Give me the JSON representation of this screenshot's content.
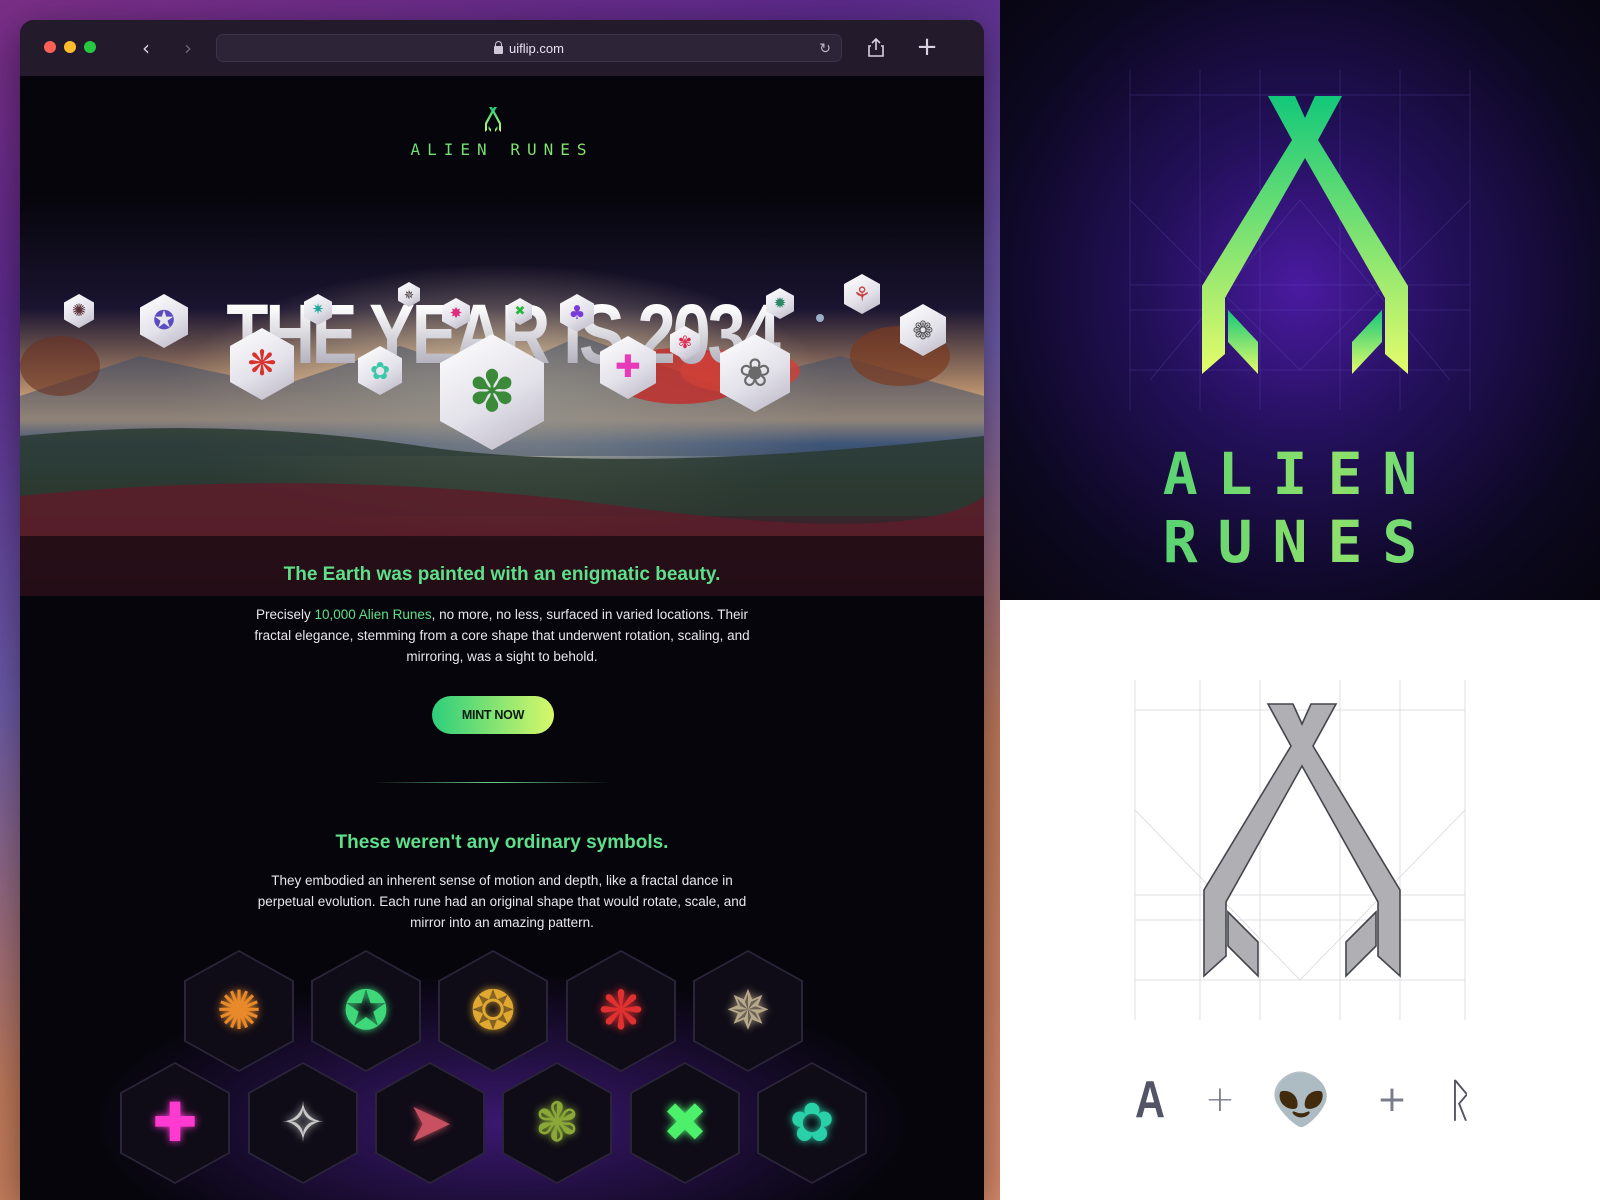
{
  "browser": {
    "url": "uiflip.com",
    "nav_back": "‹",
    "nav_forward": "›",
    "reload": "↻",
    "new_tab": "+"
  },
  "site": {
    "brand": "ALIEN RUNES",
    "hero_title": "THE YEAR IS 2034",
    "tagline": "The Earth was painted with an enigmatic beauty.",
    "para1_pre": "Precisely ",
    "para1_highlight": "10,000 Alien Runes",
    "para1_post": ", no more, no less, surfaced in varied locations. Their fractal elegance, stemming from a core shape that underwent rotation, scaling, and mirroring, was a sight to behold.",
    "cta": "MINT NOW",
    "subhead": "These weren't any ordinary symbols.",
    "para2": "They embodied an inherent sense of motion and depth, like a fractal dance in perpetual evolution. Each rune had an original shape that would rotate, scale, and mirror into an amazing pattern."
  },
  "hero_runes": [
    {
      "glyph": "✺",
      "color": "#5a3038"
    },
    {
      "glyph": "✪",
      "color": "#5a4cc0"
    },
    {
      "glyph": "❋",
      "color": "#d8322e"
    },
    {
      "glyph": "✷",
      "color": "#1ea89a"
    },
    {
      "glyph": "✿",
      "color": "#3ac8a8"
    },
    {
      "glyph": "✵",
      "color": "#403838"
    },
    {
      "glyph": "✸",
      "color": "#e02a7a"
    },
    {
      "glyph": "♣",
      "color": "#7a3ad8"
    },
    {
      "glyph": "✖",
      "color": "#2ab840"
    },
    {
      "glyph": "✚",
      "color": "#e83ab8"
    },
    {
      "glyph": "✾",
      "color": "#d8284c"
    },
    {
      "glyph": "❀",
      "color": "#6a6a6a"
    },
    {
      "glyph": "✹",
      "color": "#2a8a68"
    },
    {
      "glyph": "⚘",
      "color": "#c84040"
    },
    {
      "glyph": "❁",
      "color": "#555555"
    },
    {
      "glyph": "✽",
      "color": "#3a8a3a"
    }
  ],
  "rune_grid": [
    {
      "glyph": "✺",
      "color": "#e88a2a"
    },
    {
      "glyph": "✪",
      "color": "#3ed87a"
    },
    {
      "glyph": "❂",
      "color": "#e0a830"
    },
    {
      "glyph": "❋",
      "color": "#e03030"
    },
    {
      "glyph": "✵",
      "color": "#b8a88a"
    },
    {
      "glyph": "✚",
      "color": "#ff3ad0"
    },
    {
      "glyph": "✧",
      "color": "#c8c8c8"
    },
    {
      "glyph": "➤",
      "color": "#c85060"
    },
    {
      "glyph": "❃",
      "color": "#8aa838"
    },
    {
      "glyph": "✖",
      "color": "#4cf06a"
    },
    {
      "glyph": "✿",
      "color": "#2ad0a8"
    }
  ],
  "equation": {
    "letter": "A",
    "plus": "+",
    "alien": "👽",
    "rune": "ᚱ"
  },
  "colors": {
    "accent_green": "#5ee08a",
    "accent_lime": "#d7f86a"
  }
}
